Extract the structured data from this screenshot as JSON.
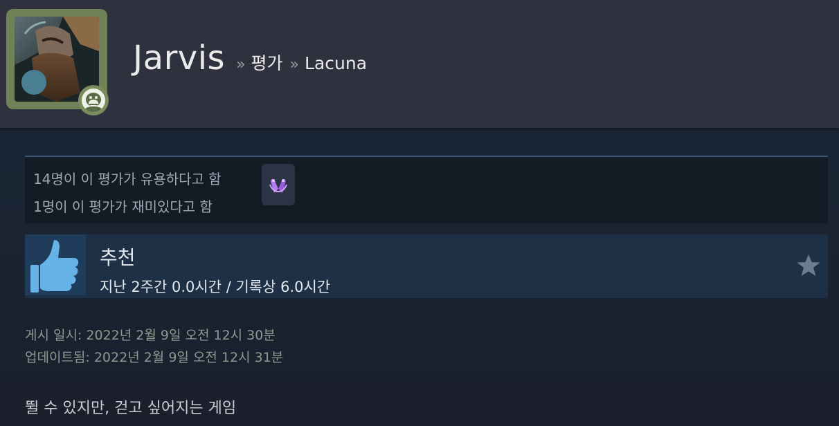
{
  "header": {
    "profile_name": "Jarvis",
    "breadcrumb_sep": "»",
    "breadcrumbs": [
      "평가",
      "Lacuna"
    ]
  },
  "votes": {
    "helpful_text": "14명이 이 평가가 유용하다고 함",
    "funny_text": "1명이 이 평가가 재미있다고 함",
    "award_icon": "award-hands-icon"
  },
  "recommendation": {
    "label": "추천",
    "hours_text": "지난 2주간 0.0시간 / 기록상 6.0시간",
    "thumb_icon": "thumbs-up-icon",
    "star_icon": "star-icon"
  },
  "posted": {
    "posted_text": "게시 일시: 2022년 2월 9일 오전 12시 30분",
    "updated_text": "업데이트됨: 2022년 2월 9일 오전 12시 31분"
  },
  "review": {
    "body": "뛸 수 있지만, 걷고 싶어지는 게임"
  },
  "colors": {
    "header_bg": "#30313f",
    "avatar_frame": "#6f8257",
    "page_bg": "#1b2838",
    "rec_bar": "#1e3045",
    "thumb_blue": "#67b3e8",
    "award_purple": "#b77cf2"
  }
}
